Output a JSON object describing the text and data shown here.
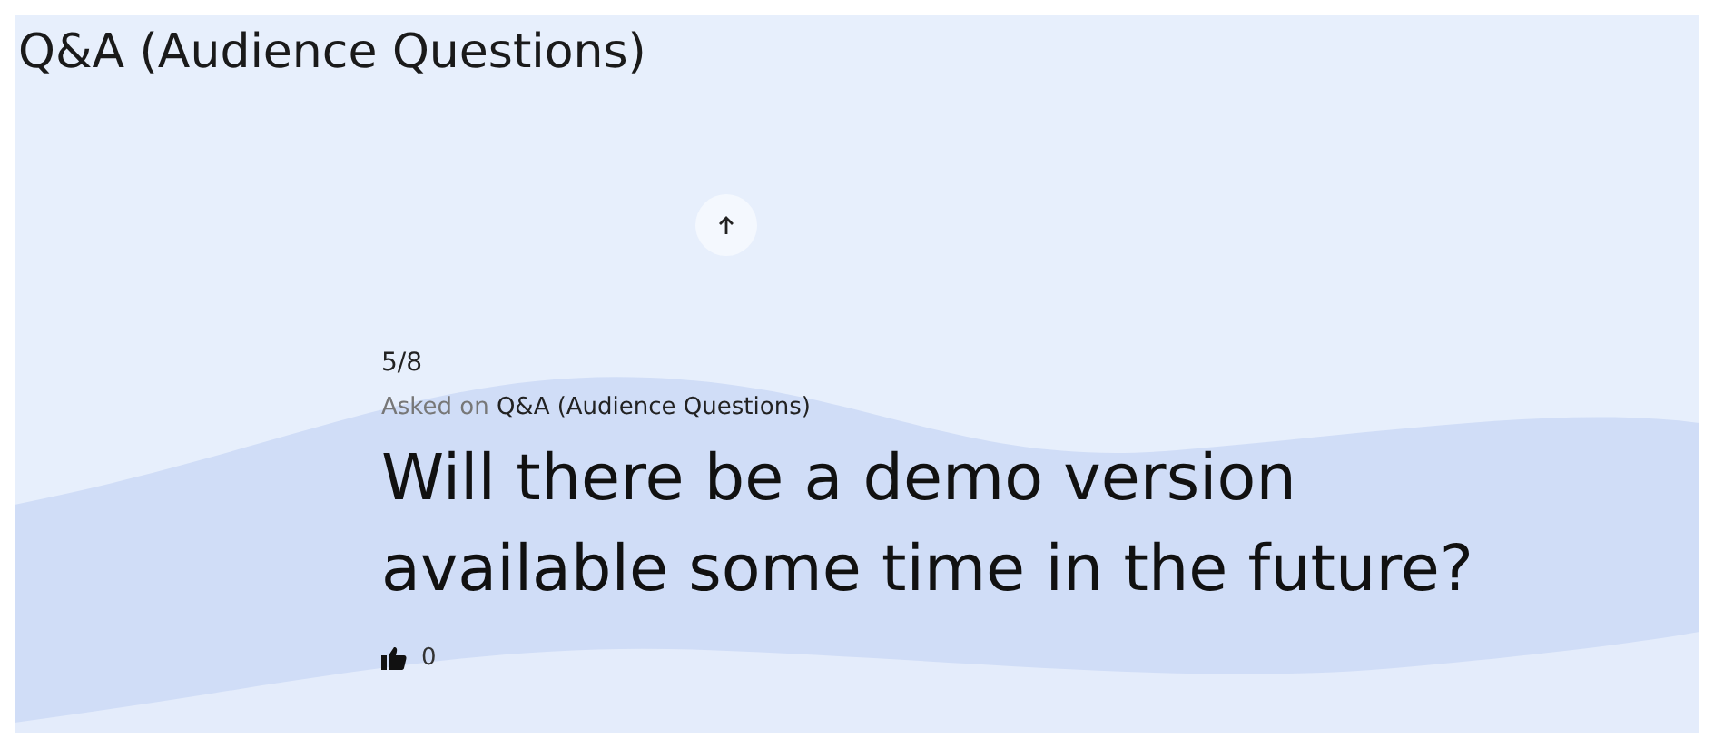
{
  "title": "Q&A (Audience Questions)",
  "counter": "5/8",
  "asked_label": "Asked on",
  "asked_source": "Q&A (Audience Questions)",
  "question": "Will there be a demo version available some time in the future?",
  "likes": "0"
}
